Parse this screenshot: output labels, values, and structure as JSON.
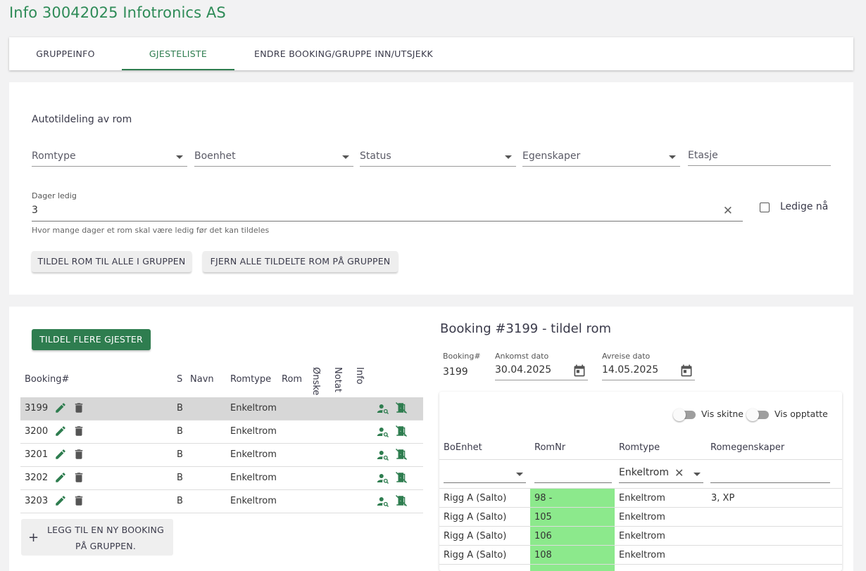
{
  "page_title": "Info 30042025 Infotronics AS",
  "tabs": [
    {
      "label": "GRUPPEINFO"
    },
    {
      "label": "GJESTELISTE"
    },
    {
      "label": "ENDRE BOOKING/GRUPPE INN/UTSJEKK"
    }
  ],
  "auto": {
    "title": "Autotildeling av rom",
    "romtype": "Romtype",
    "boenhet": "Boenhet",
    "status": "Status",
    "egenskaper": "Egenskaper",
    "etasje": "Etasje",
    "dager_label": "Dager ledig",
    "dager_value": "3",
    "dager_hint": "Hvor mange dager et rom skal være ledig før det kan tildeles",
    "ledige_na": "Ledige nå",
    "btn_tildel_alle": "TILDEL ROM TIL ALLE I GRUPPEN",
    "btn_fjern_alle": "FJERN ALLE TILDELTE ROM PÅ GRUPPEN"
  },
  "guests": {
    "btn_tildel_flere": "TILDEL FLERE GJESTER",
    "headers": {
      "booking": "Booking#",
      "s": "S",
      "navn": "Navn",
      "romtype": "Romtype",
      "rom": "Rom",
      "onske": "Ønske",
      "notat": "Notat",
      "info": "Info"
    },
    "rows": [
      {
        "booking": "3199",
        "s": "B",
        "romtype": "Enkeltrom"
      },
      {
        "booking": "3200",
        "s": "B",
        "romtype": "Enkeltrom"
      },
      {
        "booking": "3201",
        "s": "B",
        "romtype": "Enkeltrom"
      },
      {
        "booking": "3202",
        "s": "B",
        "romtype": "Enkeltrom"
      },
      {
        "booking": "3203",
        "s": "B",
        "romtype": "Enkeltrom"
      }
    ],
    "add_line1": "LEGG TIL EN NY BOOKING",
    "add_line2": "PÅ GRUPPEN.",
    "add_icon": "+"
  },
  "booking": {
    "heading": "Booking #3199 - tildel rom",
    "booking_label": "Booking#",
    "booking_value": "3199",
    "ankomst_label": "Ankomst dato",
    "ankomst_value": "30.04.2025",
    "avreise_label": "Avreise dato",
    "avreise_value": "14.05.2025",
    "vis_skitne": "Vis skitne",
    "vis_opptatte": "Vis opptatte",
    "headers": {
      "boenhet": "BoEnhet",
      "romnr": "RomNr",
      "romtype": "Romtype",
      "romegenskaper": "Romegenskaper"
    },
    "filter_romtype": "Enkeltrom",
    "rows": [
      {
        "boenhet": "Rigg A (Salto)",
        "romnr": "98 -",
        "romtype": "Enkeltrom",
        "egenskaper": "3, XP"
      },
      {
        "boenhet": "Rigg A (Salto)",
        "romnr": "105",
        "romtype": "Enkeltrom",
        "egenskaper": ""
      },
      {
        "boenhet": "Rigg A (Salto)",
        "romnr": "106",
        "romtype": "Enkeltrom",
        "egenskaper": ""
      },
      {
        "boenhet": "Rigg A (Salto)",
        "romnr": "108",
        "romtype": "Enkeltrom",
        "egenskaper": ""
      }
    ]
  },
  "colors": {
    "accent": "#2e7d4f",
    "room_free": "#8ce98c"
  }
}
